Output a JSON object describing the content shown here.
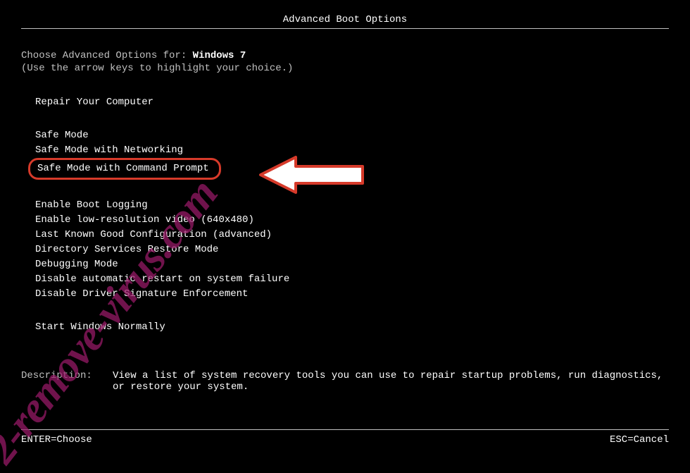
{
  "title": "Advanced Boot Options",
  "prompt_prefix": "Choose Advanced Options for: ",
  "os_name": "Windows 7",
  "hint": "(Use the arrow keys to highlight your choice.)",
  "menu": {
    "group1": [
      "Repair Your Computer"
    ],
    "group2": [
      "Safe Mode",
      "Safe Mode with Networking",
      "Safe Mode with Command Prompt"
    ],
    "group3": [
      "Enable Boot Logging",
      "Enable low-resolution video (640x480)",
      "Last Known Good Configuration (advanced)",
      "Directory Services Restore Mode",
      "Debugging Mode",
      "Disable automatic restart on system failure",
      "Disable Driver Signature Enforcement"
    ],
    "group4": [
      "Start Windows Normally"
    ]
  },
  "description": {
    "label": "Description:",
    "text": "View a list of system recovery tools you can use to repair startup problems, run diagnostics, or restore your system."
  },
  "footer": {
    "enter": "ENTER=Choose",
    "esc": "ESC=Cancel"
  },
  "watermark": "2-remove-virus.com"
}
